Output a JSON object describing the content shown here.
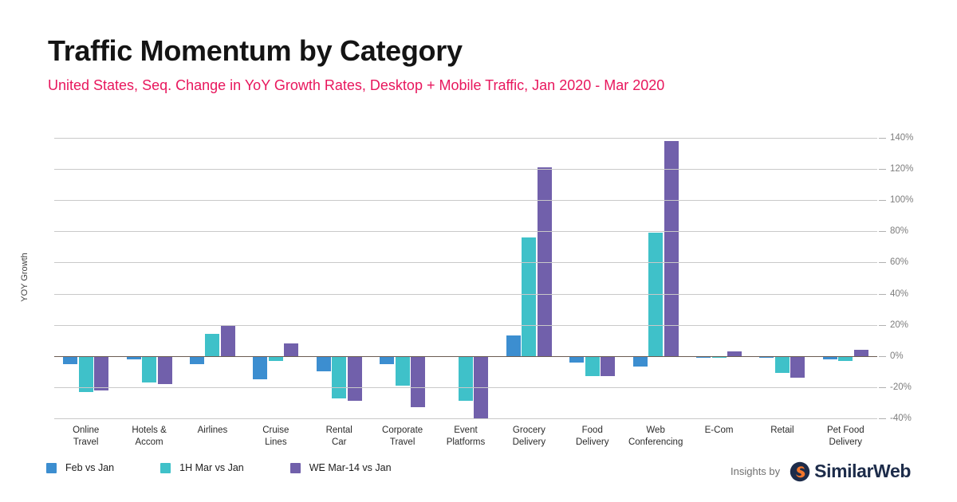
{
  "header": {
    "title": "Traffic Momentum by Category",
    "subtitle": "United States, Seq. Change in YoY Growth Rates, Desktop + Mobile Traffic, Jan 2020 - Mar 2020",
    "title_color": "#141414",
    "subtitle_color": "#e8175d"
  },
  "footer": {
    "insights_prefix": "Insights by",
    "brand_name": "SimilarWeb",
    "brand_color": "#1d2c4a",
    "brand_accent": "#f3762b"
  },
  "chart_data": {
    "type": "bar",
    "title": "Traffic Momentum by Category",
    "subtitle": "United States, Seq. Change in YoY Growth Rates, Desktop + Mobile Traffic, Jan 2020 - Mar 2020",
    "xlabel": "",
    "ylabel": "YOY Growth",
    "ylim": [
      -40,
      140
    ],
    "ytick_step": 20,
    "ytick_labels": [
      "140%",
      "120%",
      "100%",
      "80%",
      "60%",
      "40%",
      "20%",
      "0%",
      "-20%",
      "-40%"
    ],
    "ytick_values": [
      140,
      120,
      100,
      80,
      60,
      40,
      20,
      0,
      -20,
      -40
    ],
    "grid": true,
    "value_suffix": "%",
    "legend_position": "bottom-left",
    "categories": [
      "Online Travel",
      "Hotels & Accom",
      "Airlines",
      "Cruise Lines",
      "Rental Car",
      "Corporate Travel",
      "Event Platforms",
      "Grocery Delivery",
      "Food Delivery",
      "Web Conferencing",
      "E-Com",
      "Retail",
      "Pet Food Delivery"
    ],
    "category_lines": [
      [
        "Online",
        "Travel"
      ],
      [
        "Hotels &",
        "Accom"
      ],
      [
        "Airlines"
      ],
      [
        "Cruise",
        "Lines"
      ],
      [
        "Rental",
        "Car"
      ],
      [
        "Corporate",
        "Travel"
      ],
      [
        "Event",
        "Platforms"
      ],
      [
        "Grocery",
        "Delivery"
      ],
      [
        "Food",
        "Delivery"
      ],
      [
        "Web",
        "Conferencing"
      ],
      [
        "E-Com"
      ],
      [
        "Retail"
      ],
      [
        "Pet Food",
        "Delivery"
      ]
    ],
    "series": [
      {
        "name": "Feb vs Jan",
        "color": "#3c8ed0",
        "values": [
          -5,
          -2,
          -5,
          -15,
          -10,
          -5,
          0,
          13,
          -4,
          -7,
          -1,
          -1,
          -2
        ]
      },
      {
        "name": "1H Mar vs Jan",
        "color": "#3fc1c9",
        "values": [
          -23,
          -17,
          14,
          -3,
          -27,
          -19,
          -29,
          76,
          -13,
          79,
          -1,
          -11,
          -3
        ]
      },
      {
        "name": "WE Mar-14 vs Jan",
        "color": "#7160ab",
        "values": [
          -22,
          -18,
          20,
          8,
          -29,
          -33,
          -40,
          121,
          -13,
          138,
          3,
          -14,
          4
        ]
      }
    ]
  }
}
